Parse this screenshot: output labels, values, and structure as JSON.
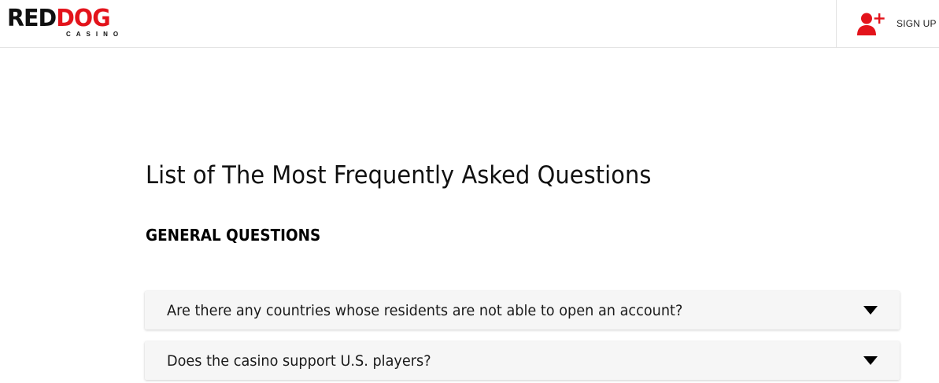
{
  "header": {
    "logo": {
      "part1": "RED",
      "part2": "DOG",
      "subtitle": "CASINO"
    },
    "signup_label": "SIGN UP",
    "signup_icon": "add-user-icon"
  },
  "main": {
    "page_title": "List of The Most Frequently Asked Questions",
    "section_title": "GENERAL QUESTIONS",
    "faq": [
      {
        "question": "Are there any countries whose residents are not able to open an account?"
      },
      {
        "question": "Does the casino support U.S. players?"
      }
    ]
  },
  "colors": {
    "brand_red": "#e3131b",
    "text": "#111111",
    "faq_background": "#f6f6f6"
  }
}
